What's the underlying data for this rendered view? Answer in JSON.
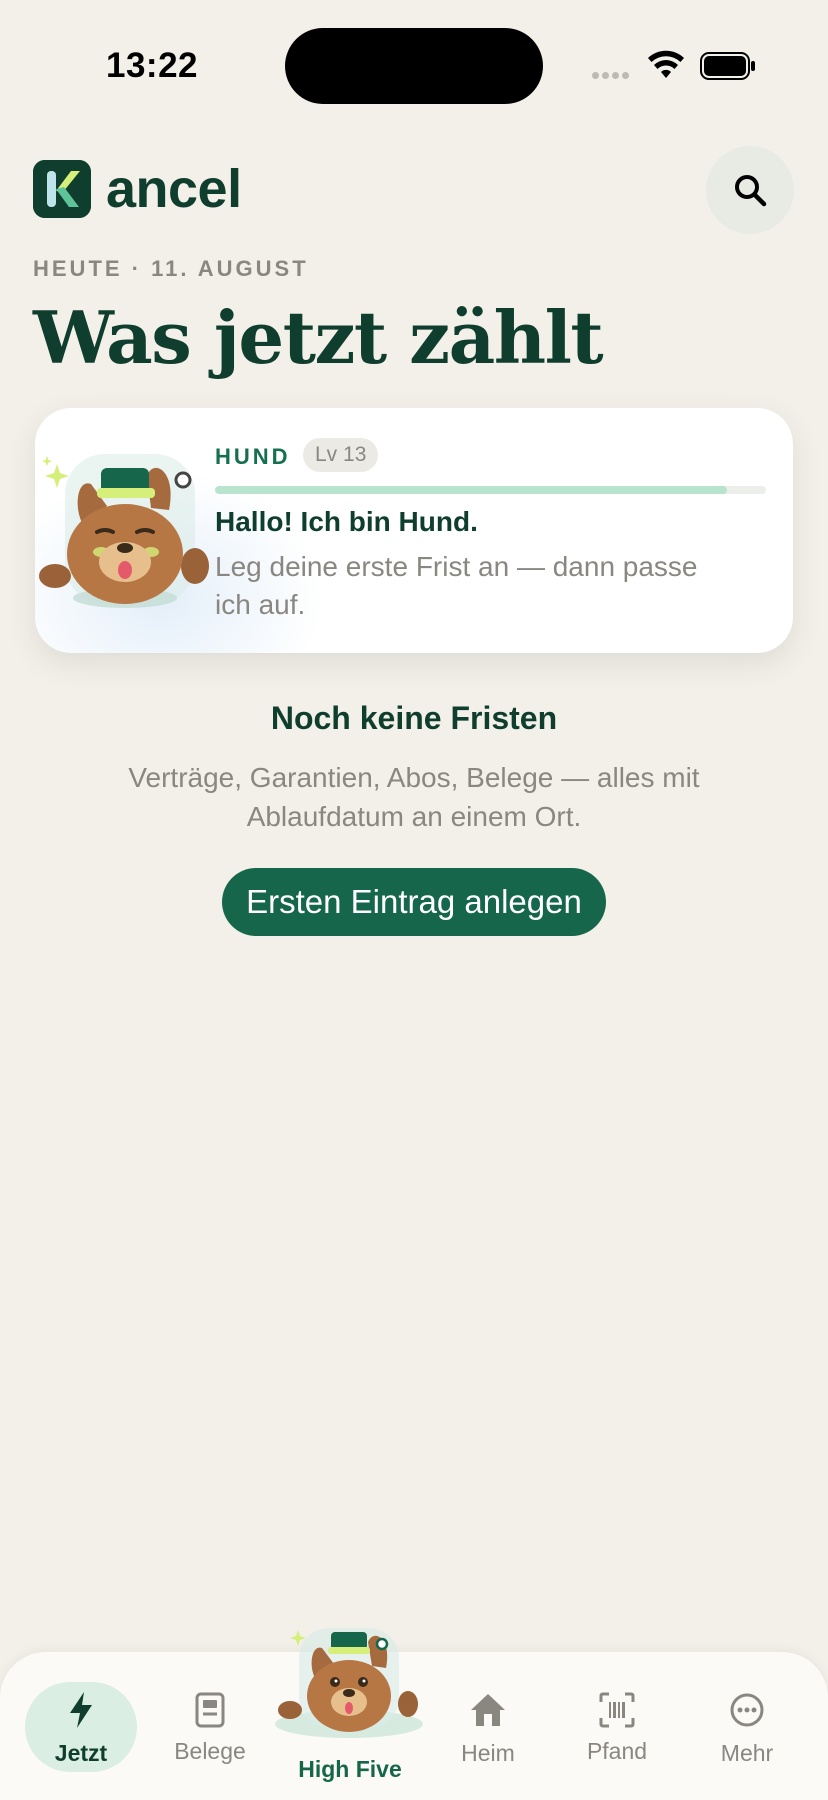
{
  "status_bar": {
    "time": "13:22"
  },
  "header": {
    "logo_letter": "K",
    "logo_text": "ancel"
  },
  "date_label": "HEUTE · 11. AUGUST",
  "page_title": "Was jetzt zählt",
  "mascot_card": {
    "name": "HUND",
    "level": "Lv 13",
    "xp_progress": 0.93,
    "heading": "Hallo! Ich bin Hund.",
    "body": "Leg deine erste Frist an — dann passe ich auf."
  },
  "empty_state": {
    "title": "Noch keine Fristen",
    "body": "Verträge, Garantien, Abos, Belege — alles mit Ablaufdatum an einem Ort.",
    "button_label": "Ersten Eintrag anlegen"
  },
  "tab_bar": {
    "tabs": [
      {
        "label": "Jetzt",
        "icon": "bolt-icon",
        "active": true
      },
      {
        "label": "Belege",
        "icon": "receipt-icon",
        "active": false
      },
      {
        "label": "High Five",
        "icon": "mascot",
        "active": false
      },
      {
        "label": "Heim",
        "icon": "home-icon",
        "active": false
      },
      {
        "label": "Pfand",
        "icon": "barcode-scan-icon",
        "active": false
      },
      {
        "label": "Mehr",
        "icon": "more-icon",
        "active": false
      }
    ]
  },
  "colors": {
    "background": "#f3f0e9",
    "brand_dark": "#0f3d2e",
    "brand_green": "#15664a",
    "muted_text": "#8a8781",
    "accent_mint": "#b8e3cd"
  }
}
